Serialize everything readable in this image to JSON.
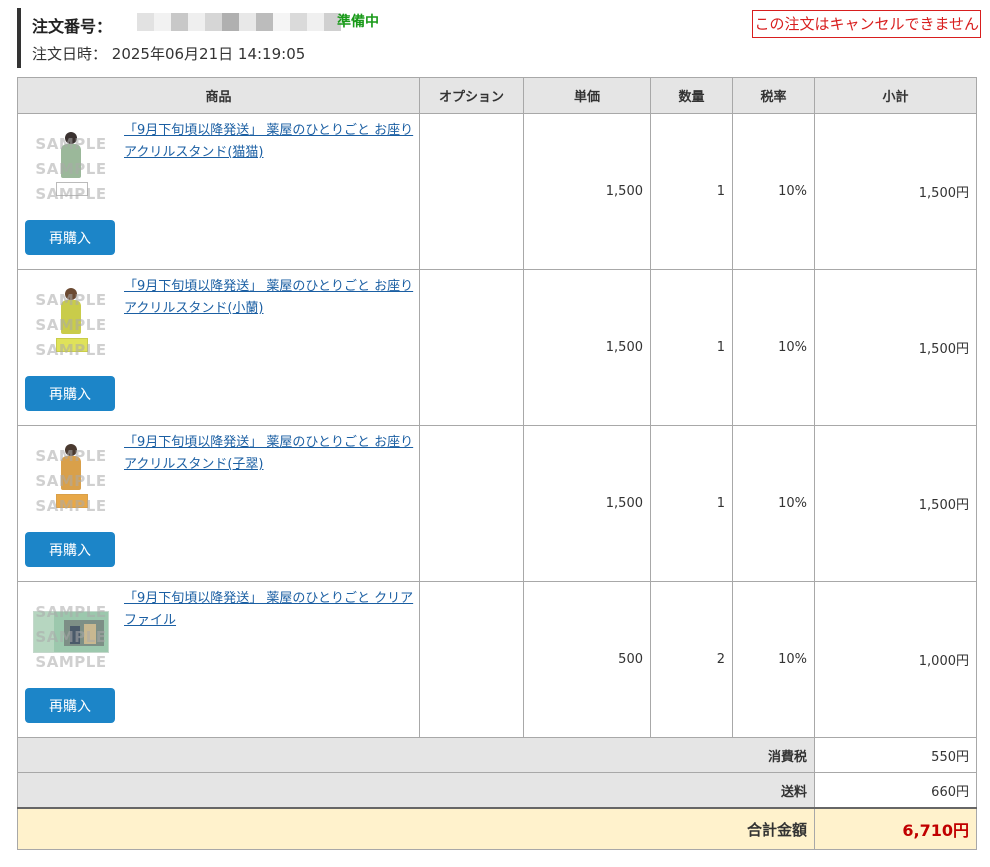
{
  "header": {
    "order_number_label": "注文番号：",
    "status": "準備中",
    "order_date_label": "注文日時：",
    "order_date": "2025年06月21日 14:19:05",
    "cancel_note": "この注文はキャンセルできません"
  },
  "table": {
    "columns": [
      "商品",
      "オプション",
      "単価",
      "数量",
      "税率",
      "小計"
    ],
    "items": [
      {
        "name": "「9月下旬頃以降発送」 薬屋のひとりごと お座りアクリルスタンド(猫猫)",
        "option": "",
        "unit_price": "1,500",
        "quantity": "1",
        "tax_rate": "10%",
        "subtotal": "1,500円",
        "rebuy_label": "再購入",
        "watermark": "SAMPLE",
        "image_color": "#9bb89a"
      },
      {
        "name": "「9月下旬頃以降発送」 薬屋のひとりごと お座りアクリルスタンド(小蘭)",
        "option": "",
        "unit_price": "1,500",
        "quantity": "1",
        "tax_rate": "10%",
        "subtotal": "1,500円",
        "rebuy_label": "再購入",
        "watermark": "SAMPLE",
        "image_color": "#c9cc4a"
      },
      {
        "name": "「9月下旬頃以降発送」 薬屋のひとりごと お座りアクリルスタンド(子翠)",
        "option": "",
        "unit_price": "1,500",
        "quantity": "1",
        "tax_rate": "10%",
        "subtotal": "1,500円",
        "rebuy_label": "再購入",
        "watermark": "SAMPLE",
        "image_color": "#d9a04a"
      },
      {
        "name": "「9月下旬頃以降発送」 薬屋のひとりごと クリアファイル",
        "option": "",
        "unit_price": "500",
        "quantity": "2",
        "tax_rate": "10%",
        "subtotal": "1,000円",
        "rebuy_label": "再購入",
        "watermark": "SAMPLE",
        "image_color": "#9cc8ad"
      }
    ]
  },
  "summary": {
    "tax_label": "消費税",
    "tax_value": "550円",
    "shipping_label": "送料",
    "shipping_value": "660円",
    "total_label": "合計金額",
    "total_value": "6,710円"
  },
  "colors": {
    "status": "#1a9a1a",
    "cancel": "#d81e1e",
    "button": "#1c85c8",
    "total": "#c00000",
    "total_row_bg": "#fff2cc",
    "link": "#1b5fa3"
  }
}
